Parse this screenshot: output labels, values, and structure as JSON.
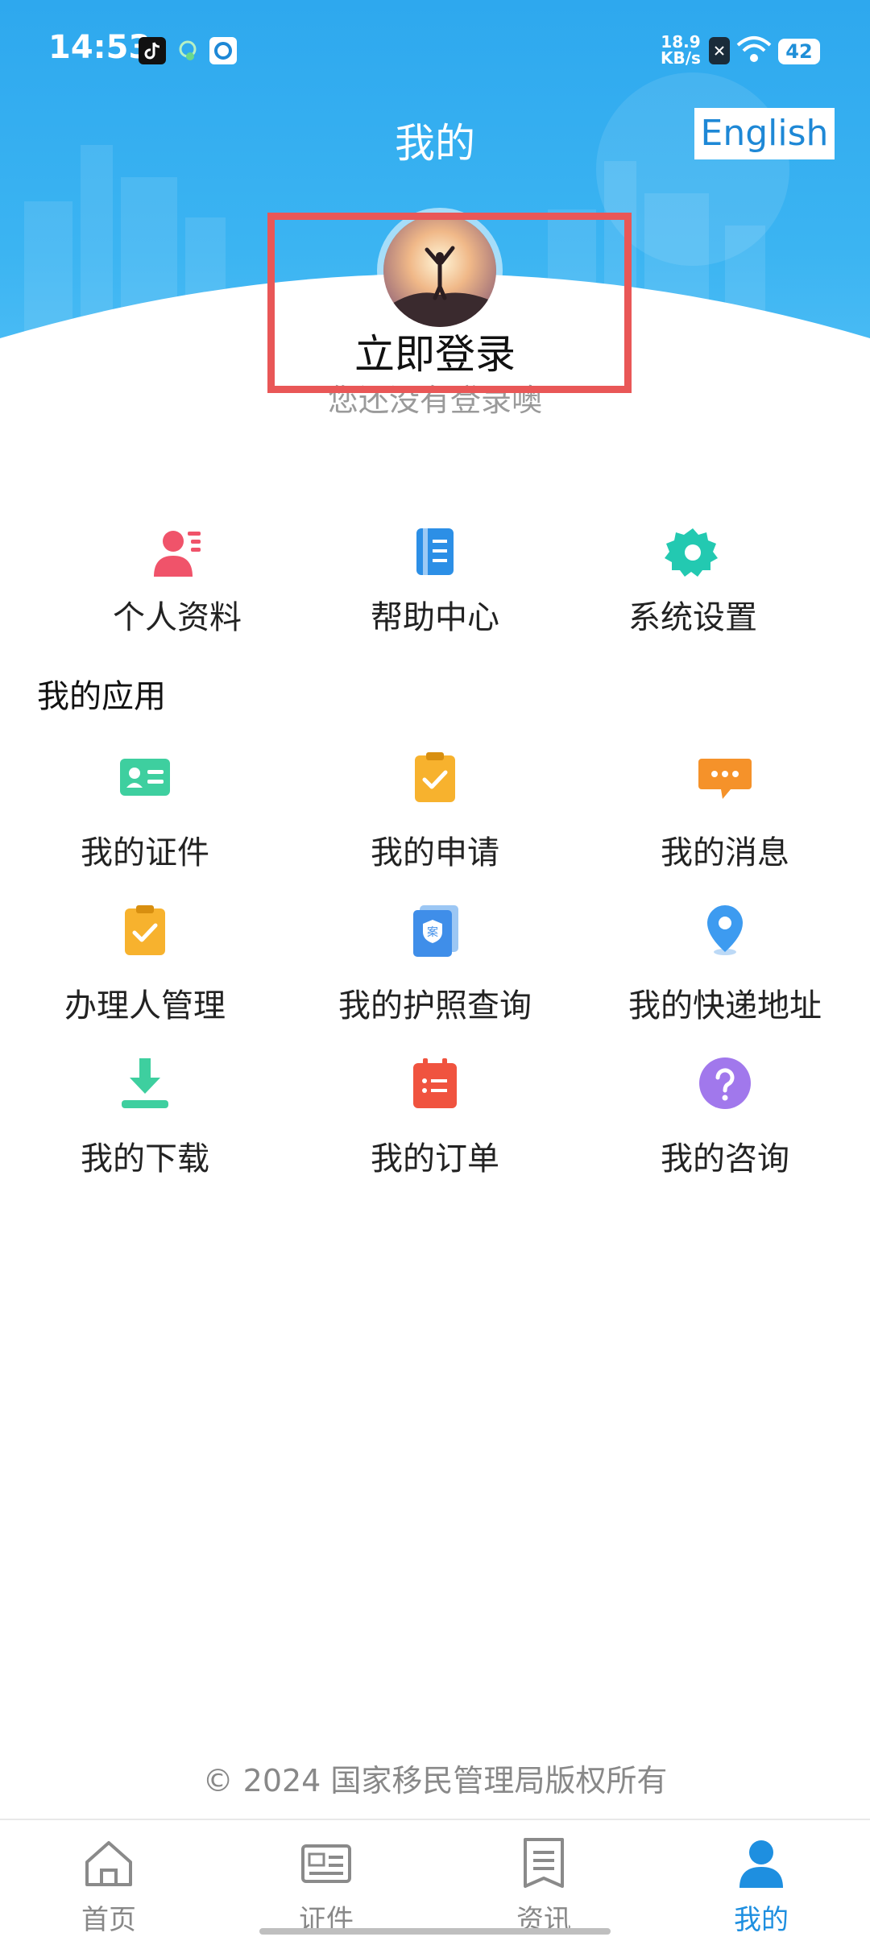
{
  "status_bar": {
    "time": "14:53",
    "net_speed_value": "18.9",
    "net_speed_unit": "KB/s",
    "battery": "42",
    "icons": [
      "tiktok-icon",
      "cloud-icon",
      "app-icon",
      "sim-icon",
      "wifi-icon",
      "battery-icon"
    ]
  },
  "header": {
    "title": "我的",
    "language_button": "English"
  },
  "profile": {
    "login_label": "立即登录",
    "subtitle": "您还没有登录噢"
  },
  "quick_actions": [
    {
      "label": "个人资料",
      "icon": "profile-icon",
      "color": "#f0536a"
    },
    {
      "label": "帮助中心",
      "icon": "book-icon",
      "color": "#2c8fe6"
    },
    {
      "label": "系统设置",
      "icon": "gear-icon",
      "color": "#23c9b1"
    }
  ],
  "apps": {
    "section_title": "我的应用",
    "items": [
      {
        "label": "我的证件",
        "icon": "id-card-icon",
        "color": "#3ecf9f"
      },
      {
        "label": "我的申请",
        "icon": "clipboard-check-icon",
        "color": "#f7b22e"
      },
      {
        "label": "我的消息",
        "icon": "chat-icon",
        "color": "#f5922a"
      },
      {
        "label": "办理人管理",
        "icon": "clipboard-check-icon",
        "color": "#f7b22e"
      },
      {
        "label": "我的护照查询",
        "icon": "passport-icon",
        "color": "#3f8ee9"
      },
      {
        "label": "我的快递地址",
        "icon": "location-pin-icon",
        "color": "#3d9bf0"
      },
      {
        "label": "我的下载",
        "icon": "download-icon",
        "color": "#3ecf9f"
      },
      {
        "label": "我的订单",
        "icon": "order-list-icon",
        "color": "#f0533f"
      },
      {
        "label": "我的咨询",
        "icon": "question-icon",
        "color": "#a178ec"
      }
    ]
  },
  "footer": {
    "copyright": "© 2024 国家移民管理局版权所有"
  },
  "tabbar": {
    "tabs": [
      {
        "label": "首页",
        "icon": "home-icon",
        "active": false
      },
      {
        "label": "证件",
        "icon": "id-card-icon",
        "active": false
      },
      {
        "label": "资讯",
        "icon": "news-icon",
        "active": false
      },
      {
        "label": "我的",
        "icon": "user-icon",
        "active": true
      }
    ],
    "active_color": "#1e8fe0"
  }
}
